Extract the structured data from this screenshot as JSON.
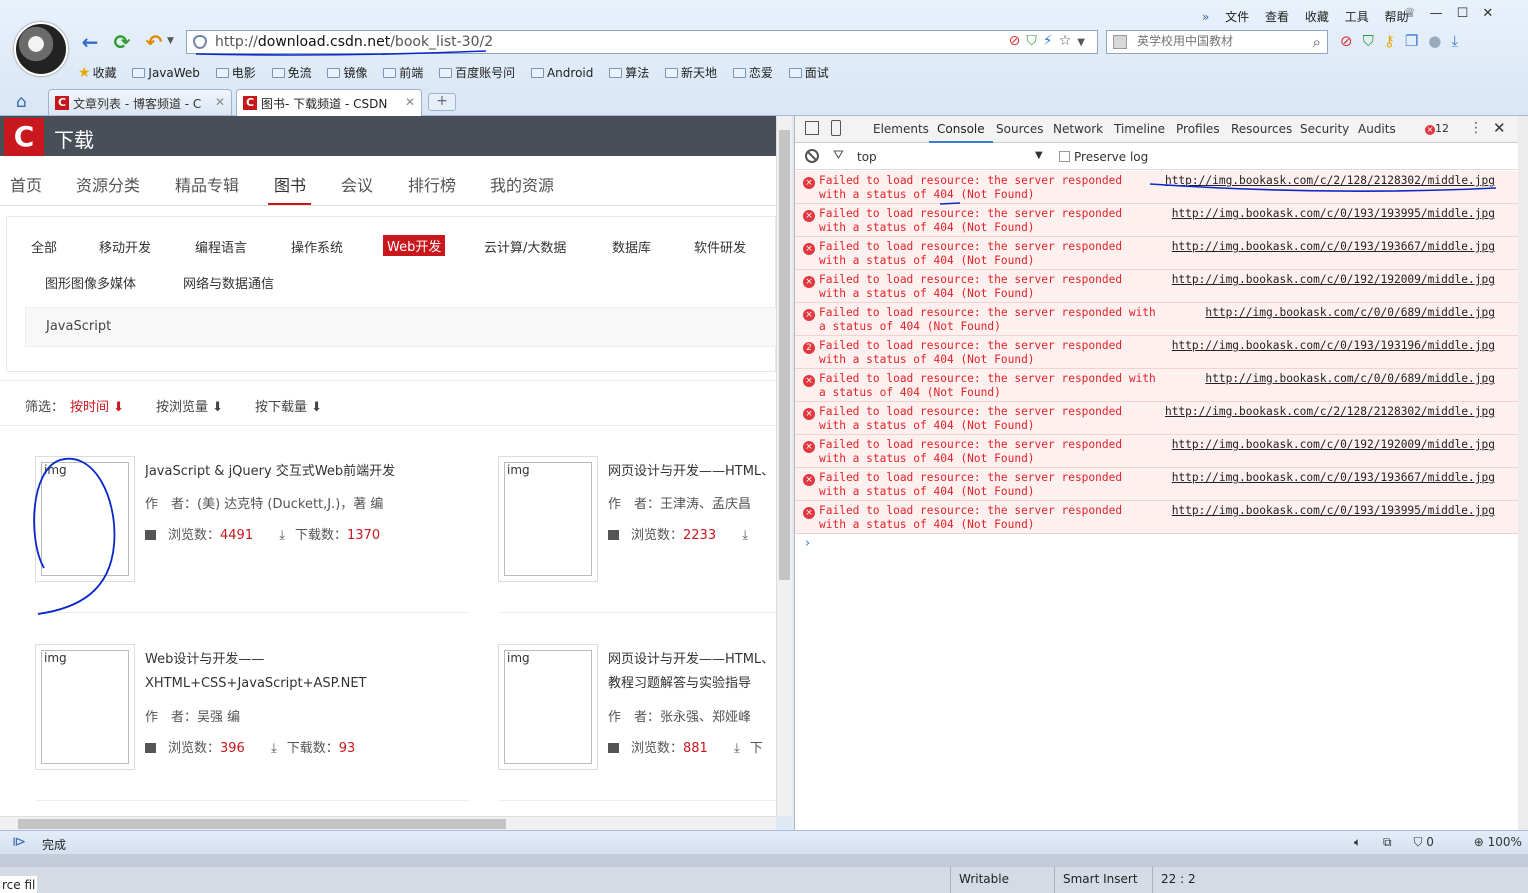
{
  "browser": {
    "url_prefix": "http://",
    "url_host": "download.csdn.net",
    "url_path": "/book_list-30/2",
    "search_placeholder": "英学校用中国教材",
    "menu": [
      "文件",
      "查看",
      "收藏",
      "工具",
      "帮助"
    ],
    "bookmarks": [
      "收藏",
      "JavaWeb",
      "电影",
      "免流",
      "镜像",
      "前端",
      "百度账号问",
      "Android",
      "算法",
      "新天地",
      "恋爱",
      "面试"
    ],
    "tabs": [
      {
        "label": "文章列表 - 博客频道 - C",
        "active": false
      },
      {
        "label": "图书- 下载频道 - CSDN",
        "active": true
      }
    ],
    "new_tab": "+"
  },
  "site": {
    "logo": "C",
    "title": "下载",
    "nav": [
      "首页",
      "资源分类",
      "精品专辑",
      "图书",
      "会议",
      "排行榜",
      "我的资源"
    ],
    "active_nav": "图书",
    "categories_row1": [
      "全部",
      "移动开发",
      "编程语言",
      "操作系统",
      "Web开发",
      "云计算/大数据",
      "数据库",
      "软件研发"
    ],
    "categories_row2": [
      "图形图像多媒体",
      "网络与数据通信"
    ],
    "selected_category": "Web开发",
    "subcategory": "JavaScript",
    "filter_label": "筛选：",
    "filters": [
      "按时间",
      "按浏览量",
      "按下载量"
    ],
    "books": [
      {
        "img_alt": "img",
        "title": "JavaScript & jQuery 交互式Web前端开发",
        "title2": "",
        "author": "作　者：(美) 达克特 (Duckett,J.)，著  编",
        "views_label": "浏览数：",
        "views": "4491",
        "downloads_label": "下载数：",
        "downloads": "1370"
      },
      {
        "img_alt": "img",
        "title": "网页设计与开发——HTML、",
        "title2": "",
        "author": "作　者：王津涛、孟庆昌",
        "views_label": "浏览数：",
        "views": "2233",
        "downloads_label": "",
        "downloads": ""
      },
      {
        "img_alt": "img",
        "title": "Web设计与开发——",
        "title2": "XHTML+CSS+JavaScript+ASP.NET",
        "author": "作　者：吴强  编",
        "views_label": "浏览数：",
        "views": "396",
        "downloads_label": "下载数：",
        "downloads": "93"
      },
      {
        "img_alt": "img",
        "title": "网页设计与开发——HTML、",
        "title2": "教程习题解答与实验指导",
        "author": "作　者：张永强、郑娅峰",
        "views_label": "浏览数：",
        "views": "881",
        "downloads_label": "下",
        "downloads": ""
      }
    ]
  },
  "devtools": {
    "tabs": [
      "Elements",
      "Console",
      "Sources",
      "Network",
      "Timeline",
      "Profiles",
      "Resources",
      "Security",
      "Audits"
    ],
    "active_tab": "Console",
    "error_count": "12",
    "context": "top",
    "preserve_log": "Preserve log",
    "messages": [
      {
        "badge": "×",
        "l1": "Failed to load resource: the server responded",
        "l2": "with a status of 404 (Not Found)",
        "url": "http://img.bookask.com/c/2/128/2128302/middle.jpg"
      },
      {
        "badge": "×",
        "l1": "Failed to load resource: the server responded",
        "l2": "with a status of 404 (Not Found)",
        "url": "http://img.bookask.com/c/0/193/193995/middle.jpg"
      },
      {
        "badge": "×",
        "l1": "Failed to load resource: the server responded",
        "l2": "with a status of 404 (Not Found)",
        "url": "http://img.bookask.com/c/0/193/193667/middle.jpg"
      },
      {
        "badge": "×",
        "l1": "Failed to load resource: the server responded",
        "l2": "with a status of 404 (Not Found)",
        "url": "http://img.bookask.com/c/0/192/192009/middle.jpg"
      },
      {
        "badge": "×",
        "l1": "Failed to load resource: the server responded with",
        "l2": "a status of 404 (Not Found)",
        "url": "http://img.bookask.com/c/0/0/689/middle.jpg"
      },
      {
        "badge": "2",
        "l1": "Failed to load resource: the server responded",
        "l2": "with a status of 404 (Not Found)",
        "url": "http://img.bookask.com/c/0/193/193196/middle.jpg"
      },
      {
        "badge": "×",
        "l1": "Failed to load resource: the server responded with",
        "l2": "a status of 404 (Not Found)",
        "url": "http://img.bookask.com/c/0/0/689/middle.jpg"
      },
      {
        "badge": "×",
        "l1": "Failed to load resource: the server responded",
        "l2": "with a status of 404 (Not Found)",
        "url": "http://img.bookask.com/c/2/128/2128302/middle.jpg"
      },
      {
        "badge": "×",
        "l1": "Failed to load resource: the server responded",
        "l2": "with a status of 404 (Not Found)",
        "url": "http://img.bookask.com/c/0/192/192009/middle.jpg"
      },
      {
        "badge": "×",
        "l1": "Failed to load resource: the server responded",
        "l2": "with a status of 404 (Not Found)",
        "url": "http://img.bookask.com/c/0/193/193667/middle.jpg"
      },
      {
        "badge": "×",
        "l1": "Failed to load resource: the server responded",
        "l2": "with a status of 404 (Not Found)",
        "url": "http://img.bookask.com/c/0/193/193995/middle.jpg"
      }
    ],
    "prompt": "›"
  },
  "statusbar": {
    "status": "完成",
    "shield_count": "0",
    "zoom": "100%"
  },
  "editor_status": {
    "left_text": "rce fil",
    "mode": "Writable",
    "insert": "Smart Insert",
    "position": "22 : 2"
  },
  "colors": {
    "brand": "#c9171e",
    "error": "#e0242a",
    "annotation": "#0a28c8"
  }
}
